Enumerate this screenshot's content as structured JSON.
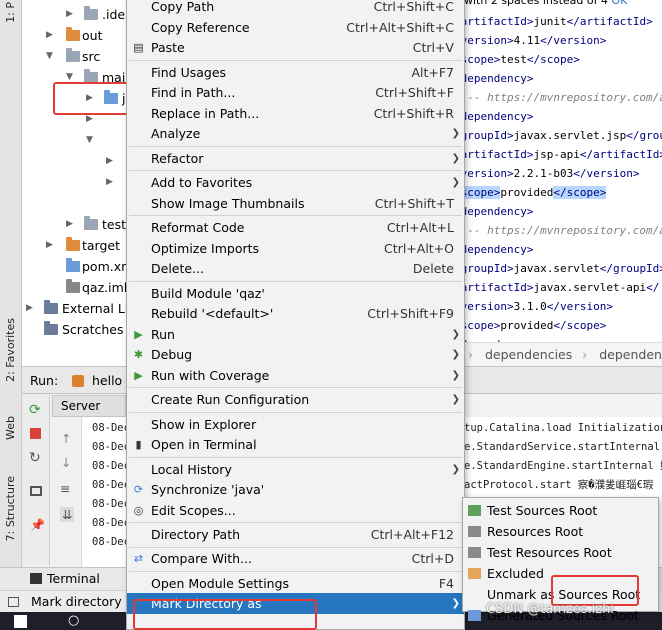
{
  "sidebar_tabs": {
    "project": "1: P",
    "favorites": "2: Favorites",
    "web": "Web",
    "structure": "7: Structure"
  },
  "project_tree": {
    "items": [
      {
        "label": ".idea",
        "kind": "folder"
      },
      {
        "label": "out",
        "kind": "folder-orange"
      },
      {
        "label": "src",
        "kind": "folder"
      },
      {
        "label": "main",
        "kind": "folder"
      },
      {
        "label": "j",
        "kind": "folder-blue"
      },
      {
        "label": "test",
        "kind": "folder"
      },
      {
        "label": "target",
        "kind": "folder-orange"
      },
      {
        "label": "pom.xm",
        "kind": "maven"
      },
      {
        "label": "qaz.iml",
        "kind": "file"
      },
      {
        "label": "External Lib",
        "kind": "lib"
      },
      {
        "label": "Scratches a",
        "kind": "scratch"
      }
    ]
  },
  "editor": {
    "header_hint": "with 2 spaces instead of 4",
    "header_ok": "OK",
    "lines": [
      {
        "open": "<artifactId>",
        "value": "junit",
        "close": "</artifactId>"
      },
      {
        "open": "<version>",
        "value": "4.11",
        "close": "</version>"
      },
      {
        "open": "<scope>",
        "value": "test",
        "close": "</scope>"
      },
      {
        "open": "<dependency>",
        "value": "",
        "close": ""
      },
      {
        "comment": "<!-- https://mvnrepository.com/artifa"
      },
      {
        "open": "<dependency>",
        "value": "",
        "close": ""
      },
      {
        "open": "<groupId>",
        "value": "javax.servlet.jsp",
        "close": "</group"
      },
      {
        "open": "<artifactId>",
        "value": "jsp-api",
        "close": "</artifactId>"
      },
      {
        "open": "<version>",
        "value": "2.2.1-b03",
        "close": "</version>"
      },
      {
        "open": "<scope>",
        "value": "provided",
        "close": "</scope>",
        "highlight": true
      },
      {
        "open": "<dependency>",
        "value": "",
        "close": ""
      },
      {
        "comment": "<!-- https://mvnrepository.com/artifa"
      },
      {
        "open": "<dependency>",
        "value": "",
        "close": ""
      },
      {
        "open": "<groupId>",
        "value": "javax.servlet",
        "close": "</groupId>"
      },
      {
        "open": "<artifactId>",
        "value": "javax.servlet-api",
        "close": "</"
      },
      {
        "open": "<version>",
        "value": "3.1.0",
        "close": "</version>"
      },
      {
        "open": "<scope>",
        "value": "provided",
        "close": "</scope>"
      },
      {
        "open": "<dependency>",
        "value": "",
        "close": ""
      }
    ],
    "breadcrumb": [
      "dependencies",
      "dependency"
    ]
  },
  "run_panel": {
    "title": "Run:",
    "config": "hello",
    "server_tab": "Server",
    "log_prefix": "08-Dec",
    "log_lines": [
      "tup.Catalina.load Initialization",
      "e.StandardService.startInternal 始",
      "e.StandardEngine.startInternal 妷",
      "actProtocol.start 察�濮夎崕瑙€瑕",
      "",
      "",
      ""
    ]
  },
  "bottom": {
    "terminal_tab": "Terminal",
    "status_text": "Mark directory a"
  },
  "context_menu": {
    "items": [
      {
        "label": "Copy Path",
        "shortcut": "Ctrl+Shift+C"
      },
      {
        "label": "Copy Reference",
        "shortcut": "Ctrl+Alt+Shift+C"
      },
      {
        "label": "Paste",
        "shortcut": "Ctrl+V",
        "icon": "paste-icon"
      },
      {
        "sep": true
      },
      {
        "label": "Find Usages",
        "shortcut": "Alt+F7"
      },
      {
        "label": "Find in Path...",
        "shortcut": "Ctrl+Shift+F"
      },
      {
        "label": "Replace in Path...",
        "shortcut": "Ctrl+Shift+R"
      },
      {
        "label": "Analyze",
        "submenu": true
      },
      {
        "sep": true
      },
      {
        "label": "Refactor",
        "submenu": true
      },
      {
        "sep": true
      },
      {
        "label": "Add to Favorites",
        "submenu": true
      },
      {
        "label": "Show Image Thumbnails",
        "shortcut": "Ctrl+Shift+T"
      },
      {
        "sep": true
      },
      {
        "label": "Reformat Code",
        "shortcut": "Ctrl+Alt+L"
      },
      {
        "label": "Optimize Imports",
        "shortcut": "Ctrl+Alt+O"
      },
      {
        "label": "Delete...",
        "shortcut": "Delete"
      },
      {
        "sep": true
      },
      {
        "label": "Build Module 'qaz'",
        "shortcut": ""
      },
      {
        "label": "Rebuild '<default>'",
        "shortcut": "Ctrl+Shift+F9"
      },
      {
        "label": "Run",
        "submenu": true,
        "icon": "run-icon"
      },
      {
        "label": "Debug",
        "submenu": true,
        "icon": "debug-icon"
      },
      {
        "label": "Run with Coverage",
        "submenu": true,
        "icon": "coverage-icon"
      },
      {
        "sep": true
      },
      {
        "label": "Create Run Configuration",
        "submenu": true
      },
      {
        "sep": true
      },
      {
        "label": "Show in Explorer",
        "shortcut": ""
      },
      {
        "label": "Open in Terminal",
        "shortcut": "",
        "icon": "terminal-icon"
      },
      {
        "sep": true
      },
      {
        "label": "Local History",
        "submenu": true
      },
      {
        "label": "Synchronize 'java'",
        "shortcut": "",
        "icon": "sync-icon"
      },
      {
        "label": "Edit Scopes...",
        "shortcut": "",
        "icon": "scopes-icon"
      },
      {
        "sep": true
      },
      {
        "label": "Directory Path",
        "shortcut": "Ctrl+Alt+F12"
      },
      {
        "sep": true
      },
      {
        "label": "Compare With...",
        "shortcut": "Ctrl+D",
        "icon": "compare-icon"
      },
      {
        "sep": true
      },
      {
        "label": "Open Module Settings",
        "shortcut": "F4"
      },
      {
        "label": "Mark Directory as",
        "submenu": true,
        "active": true
      }
    ]
  },
  "submenu": {
    "items": [
      {
        "label": "Test Sources Root",
        "color": "#5fa05f"
      },
      {
        "label": "Resources Root",
        "color": "#8a8a8a"
      },
      {
        "label": "Test Resources Root",
        "color": "#8a8a8a"
      },
      {
        "label": "Excluded",
        "color": "#e8a35a"
      },
      {
        "label": "Unmark as Sources Root",
        "color": ""
      },
      {
        "label": "Generated Sources Root",
        "color": "#6a9ad8"
      }
    ]
  },
  "watermark": "CSDN @tamzes.izhi",
  "colors": {
    "menu_active": "#2675bf",
    "annotation_red": "#e53935",
    "tag": "#000080"
  }
}
